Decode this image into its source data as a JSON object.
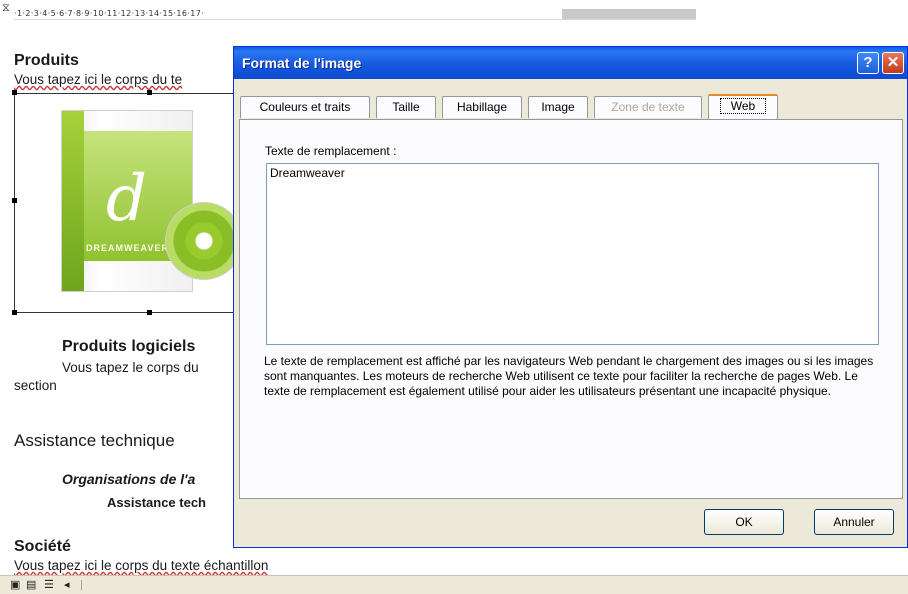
{
  "ruler": {
    "marks": "·1·2·3·4·5·6·7·8·9·10·11·12·13·14·15·16·17·"
  },
  "document": {
    "heading_produits": "Produits",
    "body_1": "Vous tapez ici le corps du te",
    "heading_produits_logiciels": "Produits logiciels",
    "body_2a": "Vous tapez le corps du",
    "body_2b": "section",
    "heading_assistance": "Assistance technique",
    "subheading_orgs": "Organisations de l'a",
    "subheading_assistance": "Assistance tech",
    "heading_societe": "Société",
    "body_3": "Vous tapez ici le corps du texte échantillon",
    "image": {
      "product_name": "DREAMWEAVER",
      "logo_letter": "d"
    }
  },
  "dialog": {
    "title": "Format de l'image",
    "help_icon": "?",
    "close_icon": "✕",
    "tabs": [
      {
        "label": "Couleurs et traits",
        "state": "normal"
      },
      {
        "label": "Taille",
        "state": "normal"
      },
      {
        "label": "Habillage",
        "state": "normal"
      },
      {
        "label": "Image",
        "state": "normal"
      },
      {
        "label": "Zone de texte",
        "state": "disabled"
      },
      {
        "label": "Web",
        "state": "active"
      }
    ],
    "alt_text_label": "Texte de remplacement :",
    "alt_text_value": "Dreamweaver",
    "help_text": "Le texte de remplacement est affiché par les navigateurs Web pendant le chargement des images ou si les images sont manquantes. Les moteurs de recherche Web utilisent ce texte pour faciliter la recherche de pages Web. Le texte de remplacement est également utilisé pour aider les utilisateurs présentant une incapacité physique.",
    "ok_label": "OK",
    "cancel_label": "Annuler"
  },
  "statusbar": {
    "icons": [
      "normal-view-icon",
      "web-view-icon",
      "outline-view-icon",
      "scroll-left-icon"
    ]
  }
}
